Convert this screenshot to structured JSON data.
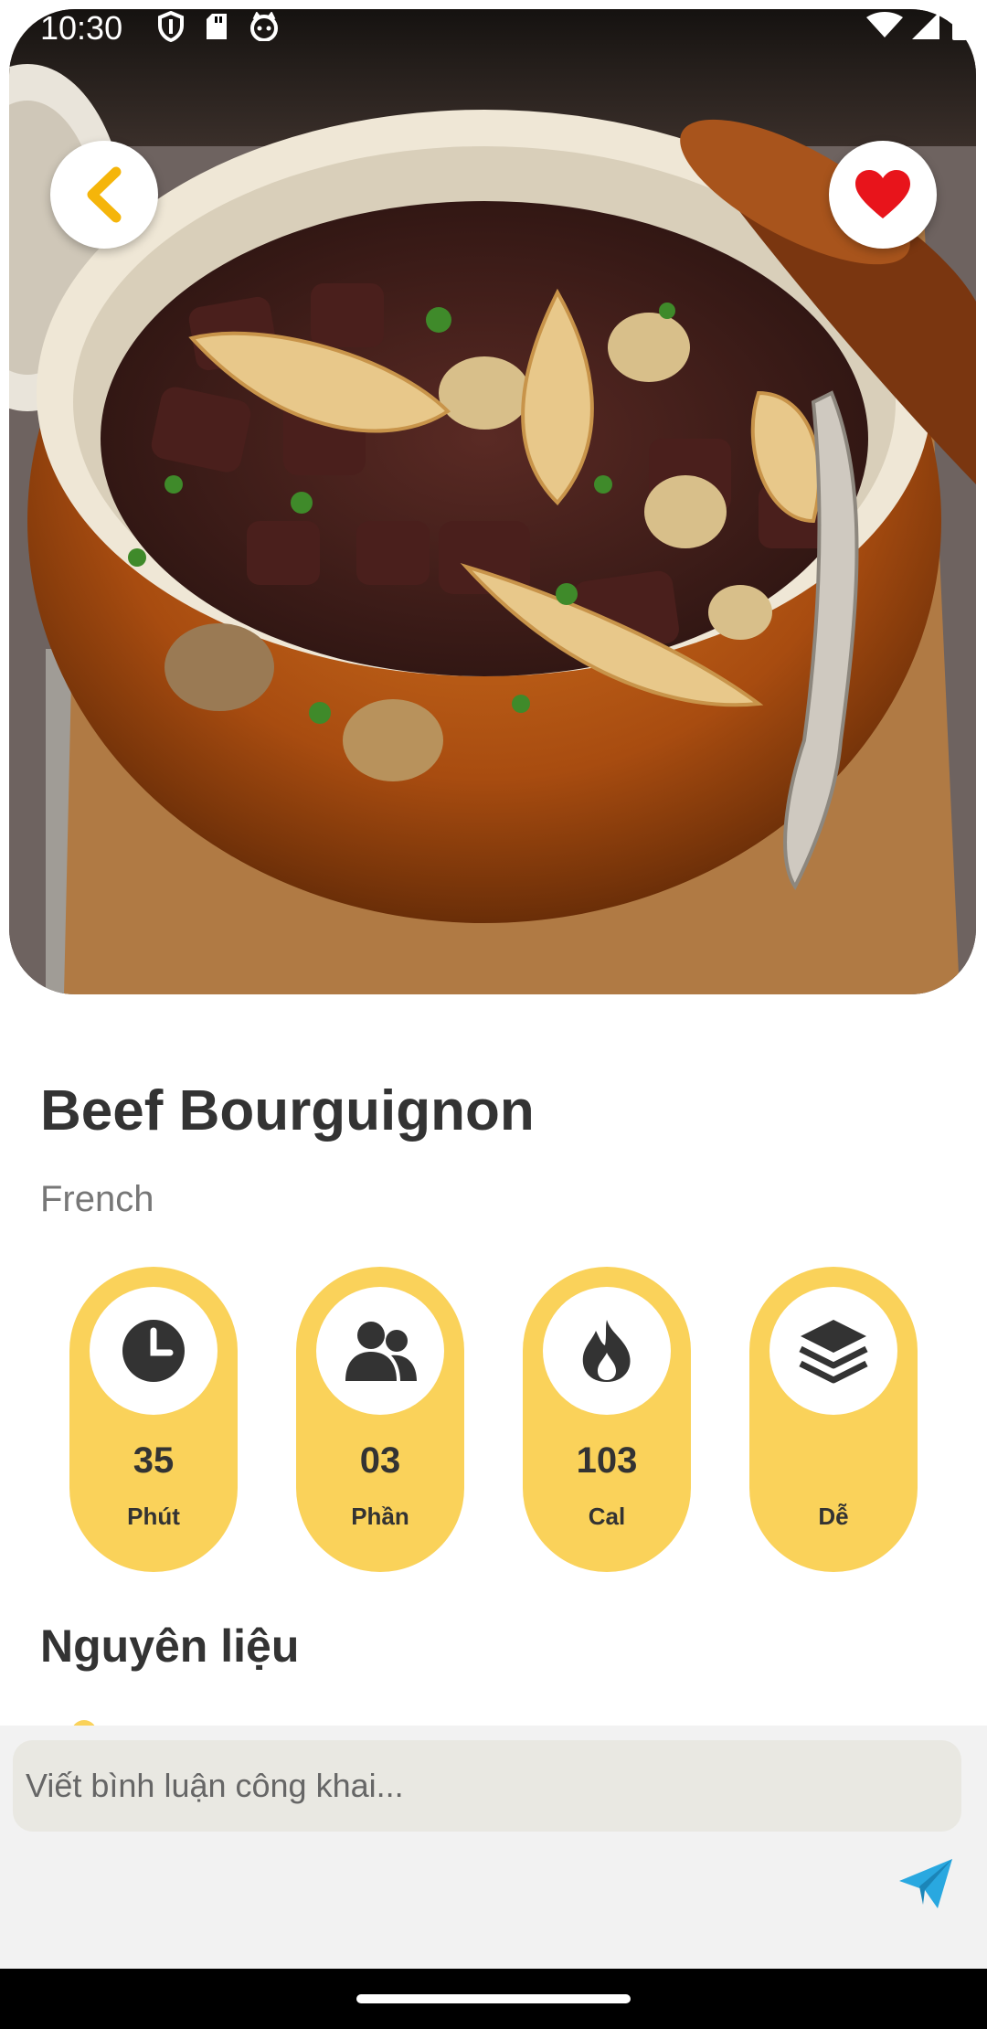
{
  "status_bar": {
    "time": "10:30",
    "left_icons": [
      "shield-icon",
      "sd-card-icon",
      "cat-face-icon"
    ],
    "right_icons": [
      "wifi-icon",
      "signal-icon",
      "battery-icon"
    ]
  },
  "hero": {
    "image_subject": "Beef Bourguignon in a brown ceramic pot with mushrooms, onions and a spoon",
    "back_icon": "chevron-left-icon",
    "favorite_icon": "heart-icon",
    "favorite_active": true
  },
  "recipe": {
    "title": "Beef Bourguignon",
    "cuisine": "French"
  },
  "stats": [
    {
      "icon": "clock-icon",
      "value": "35",
      "label": "Phút"
    },
    {
      "icon": "people-icon",
      "value": "03",
      "label": "Phần"
    },
    {
      "icon": "flame-icon",
      "value": "103",
      "label": "Cal"
    },
    {
      "icon": "layers-icon",
      "value": "",
      "label": "Dễ"
    }
  ],
  "ingredients": {
    "heading": "Nguyên liệu"
  },
  "comment": {
    "placeholder": "Viết bình luận công khai...",
    "send_icon": "send-icon"
  },
  "colors": {
    "accent_yellow": "#fad25a",
    "back_chevron": "#f5b50a",
    "heart_red": "#e8141b",
    "send_blue": "#29a8e0",
    "text_dark": "#333333",
    "text_muted": "#777777"
  }
}
